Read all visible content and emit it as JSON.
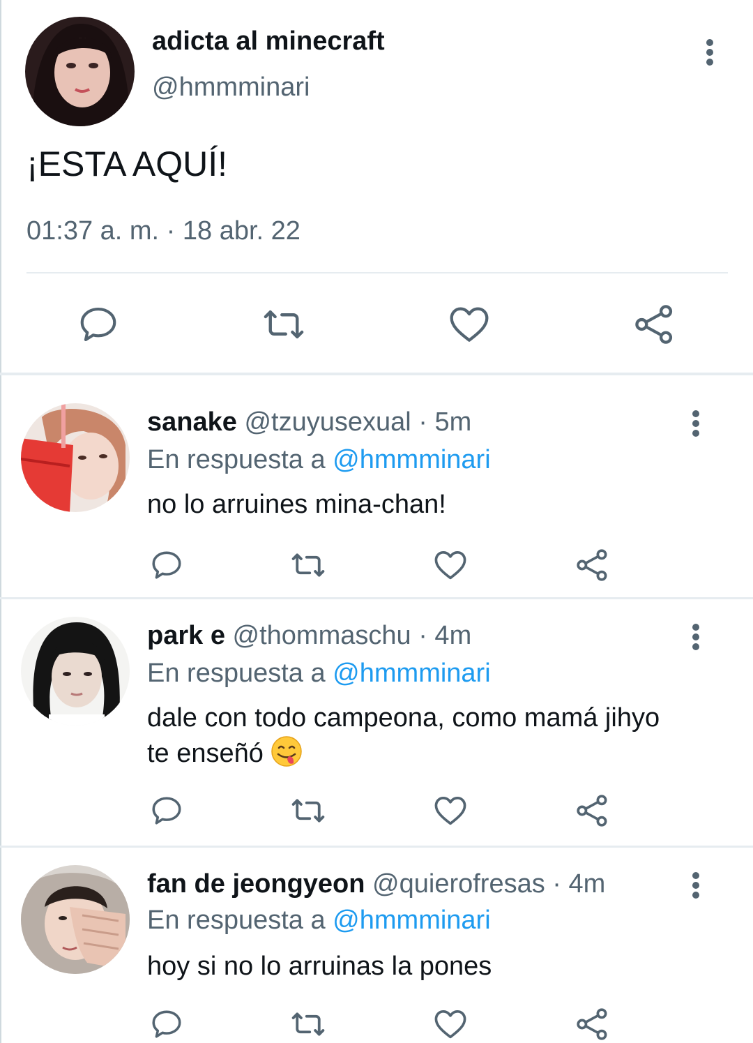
{
  "tweet": {
    "display_name": "adicta al minecraft",
    "handle": "@hmmminari",
    "text": "¡ESTA AQUÍ!",
    "timestamp": "01:37 a. m. · 18 abr. 22"
  },
  "icons": {
    "reply": "reply-icon",
    "retweet": "retweet-icon",
    "like": "heart-icon",
    "share": "share-icon",
    "more": "more-vertical-icon"
  },
  "colors": {
    "text": "#0f1419",
    "secondary": "#536471",
    "mention": "#1d9bf0",
    "divider": "#e6ecf0"
  },
  "replies": [
    {
      "name": "sanake",
      "handle": "@tzuyusexual",
      "time": "· 5m",
      "reply_prefix": "En respuesta a",
      "reply_to": "@hmmminari",
      "text": "no lo arruines mina-chan!"
    },
    {
      "name": "park e",
      "handle": "@thommaschu",
      "time": "· 4m",
      "reply_prefix": "En respuesta a",
      "reply_to": "@hmmminari",
      "text": "dale con todo campeona, como mamá jihyo te enseñó",
      "emoji": "face-savoring-food-emoji"
    },
    {
      "name": "fan de jeongyeon",
      "handle": "@quierofresas",
      "time": "· 4m",
      "reply_prefix": "En respuesta a",
      "reply_to": "@hmmminari",
      "text": "hoy si no lo arruinas la pones"
    }
  ]
}
